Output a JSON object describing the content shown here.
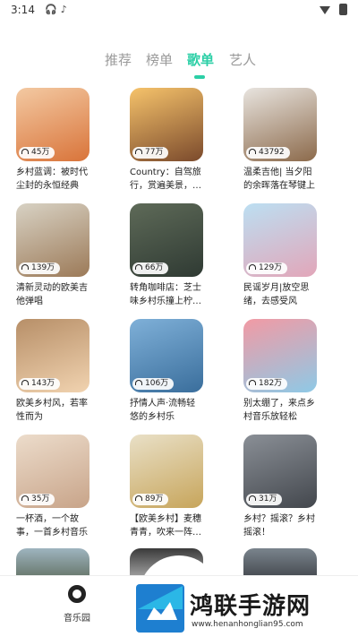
{
  "status_bar": {
    "time": "3:14",
    "icons": [
      "headphones-icon",
      "tiktok-icon"
    ]
  },
  "tabs": [
    {
      "label": "推荐",
      "active": false
    },
    {
      "label": "榜单",
      "active": false
    },
    {
      "label": "歌单",
      "active": true
    },
    {
      "label": "艺人",
      "active": false
    }
  ],
  "playlists": [
    {
      "plays": "45万",
      "title": "乡村蓝调：被时代尘封的永恒经典",
      "colors": [
        "#f3c9a2",
        "#d9743a"
      ]
    },
    {
      "plays": "77万",
      "title": "Country：自驾旅行，赏遍美景，…",
      "colors": [
        "#f6c36b",
        "#7b4a2c"
      ]
    },
    {
      "plays": "43792",
      "title": "温柔吉他| 当夕阳的余晖落在琴键上",
      "colors": [
        "#e8e4df",
        "#8c6a4b"
      ]
    },
    {
      "plays": "139万",
      "title": "清新灵动的欧美吉他弹唱",
      "colors": [
        "#d8d2c4",
        "#9c7a58"
      ]
    },
    {
      "plays": "66万",
      "title": "转角咖啡店：芝士味乡村乐撞上柠…",
      "colors": [
        "#5e6a58",
        "#2f3a33"
      ]
    },
    {
      "plays": "129万",
      "title": "民谣岁月|放空思绪，去感受风",
      "colors": [
        "#bcdff2",
        "#e2a6b9"
      ]
    },
    {
      "plays": "143万",
      "title": "欧美乡村风，若率性而为",
      "colors": [
        "#b78f68",
        "#f1d3b0"
      ]
    },
    {
      "plays": "106万",
      "title": "抒情人声·流畅轻悠的乡村乐",
      "colors": [
        "#7fb0d8",
        "#3a6e9c"
      ]
    },
    {
      "plays": "182万",
      "title": "别太绷了，来点乡村音乐放轻松",
      "colors": [
        "#f29aa4",
        "#8ec9e6"
      ]
    },
    {
      "plays": "35万",
      "title": "一杯酒，一个故事，一首乡村音乐",
      "colors": [
        "#ecdccb",
        "#c8a489"
      ]
    },
    {
      "plays": "89万",
      "title": "【欧美乡村】麦穗青青，吹来一阵…",
      "colors": [
        "#e9e0c7",
        "#c7a55b"
      ]
    },
    {
      "plays": "31万",
      "title": "乡村？摇滚？乡村摇滚！",
      "colors": [
        "#8a8f96",
        "#43474d"
      ]
    }
  ],
  "partial_row_colors": [
    [
      "#9eb4bf",
      "#6c7c72"
    ],
    [
      "#3a3a3a",
      "#9a9a9a"
    ],
    [
      "#7a848d",
      "#4a4f55"
    ]
  ],
  "bottom_nav": {
    "music_label": "音乐园"
  },
  "watermark": {
    "text": "鸿联手游网",
    "url": "www.henanhonglian95.com"
  },
  "accent_color": "#2bcfa6"
}
